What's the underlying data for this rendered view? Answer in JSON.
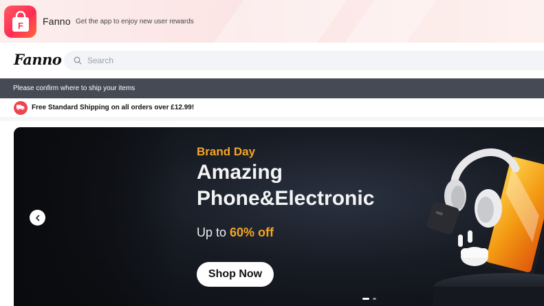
{
  "app_promo": {
    "app_name": "Fanno",
    "subtitle": "Get the app to enjoy new user rewards",
    "icon": "shopping-bag-icon",
    "icon_letter": "F"
  },
  "header": {
    "logo": "Fanno",
    "search": {
      "placeholder": "Search",
      "value": "",
      "icon": "search-icon"
    }
  },
  "ship_bar": {
    "text": "Please confirm where to ship your items"
  },
  "free_shipping": {
    "icon": "truck-icon",
    "text": "Free Standard Shipping on all orders over £12.99!"
  },
  "banner": {
    "eyebrow": "Brand Day",
    "headline_line1": "Amazing",
    "headline_line2": "Phone&Electronic",
    "offer_prefix": "Up to ",
    "offer_value": "60% off",
    "cta": "Shop Now",
    "prev_icon": "chevron-left-icon",
    "slide_count": 2,
    "active_slide": 1
  },
  "colors": {
    "accent_orange": "#f5a623",
    "brand_red": "#ff2d55",
    "ship_bar_bg": "#464a55"
  }
}
